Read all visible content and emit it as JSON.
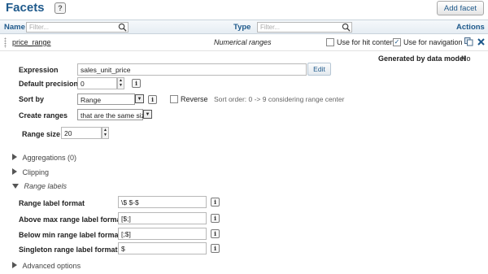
{
  "header": {
    "title": "Facets",
    "help": "?",
    "add_button": "Add facet"
  },
  "table_header": {
    "name_label": "Name",
    "name_placeholder": "Filter...",
    "type_label": "Type",
    "type_placeholder": "Filter...",
    "actions_label": "Actions"
  },
  "facet": {
    "name": "price_range",
    "type": "Numerical ranges",
    "hit_content_label": "Use for hit content",
    "hit_content_checked": false,
    "navigation_label": "Use for navigation",
    "navigation_checked": true,
    "check_mark": "✓",
    "generated_label": "Generated by data model",
    "generated_value": "No"
  },
  "form": {
    "expression_label": "Expression",
    "expression_value": "sales_unit_price",
    "edit_label": "Edit",
    "precision_label": "Default precision",
    "precision_value": "0",
    "sort_label": "Sort by",
    "sort_value": "Range",
    "reverse_label": "Reverse",
    "reverse_checked": false,
    "sort_hint": "Sort order: 0 -> 9 considering range center",
    "create_label": "Create ranges",
    "create_value": "that are the same size",
    "range_size_label": "Range size",
    "range_size_value": "20",
    "info": "i",
    "spin_up": "▲",
    "spin_down": "▼",
    "dropdown_arrow": "▼"
  },
  "sections": {
    "aggregations": "Aggregations (0)",
    "clipping": "Clipping",
    "range_labels": "Range labels",
    "advanced": "Advanced options"
  },
  "range_labels": {
    "format_label": "Range label format",
    "format_value": "\\$ $-$",
    "above_label": "Above max range label format",
    "above_value": "[$;]",
    "below_label": "Below min range label format",
    "below_value": "[;$]",
    "singleton_label": "Singleton range label format",
    "singleton_value": "$"
  },
  "colors": {
    "accent": "#1f5a8c",
    "header_bar": "#e6edf3",
    "delete": "#1f5a8c"
  },
  "icons": {
    "help": "help-icon",
    "filter_search": "magnifier-icon",
    "copy": "copy-icon",
    "delete": "close-icon",
    "info": "info-icon",
    "collapsed": "triangle-right-icon",
    "expanded": "triangle-down-icon"
  }
}
